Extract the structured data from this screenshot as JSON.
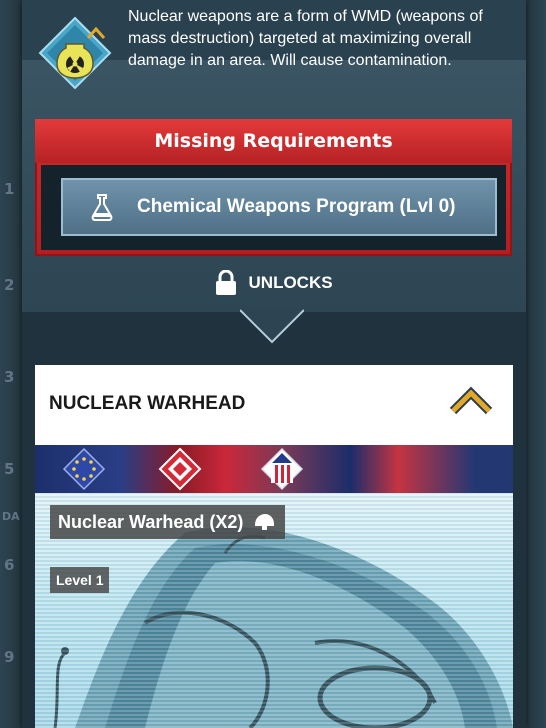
{
  "description": {
    "text": "Nuclear weapons are a form of WMD (weapons of mass destruction) targeted at maximizing overall damage in an area. Will cause contamination.",
    "icon": "nuclear-hazard-icon"
  },
  "requirements": {
    "title": "Missing Requirements",
    "items": [
      {
        "label": "Chemical Weapons Program (Lvl 0)",
        "icon": "flask-research-icon"
      }
    ]
  },
  "unlocks": {
    "label": "UNLOCKS",
    "icon": "lock-icon"
  },
  "card": {
    "title": "NUCLEAR WARHEAD",
    "rank_icon": "chevron-rank-icon",
    "factions": [
      "eu-faction-icon",
      "red-faction-icon",
      "us-faction-icon"
    ],
    "item_name": "Nuclear Warhead (X2)",
    "item_icon": "helmet-icon",
    "level": "Level 1"
  },
  "background": {
    "left_numbers": [
      "1",
      "2",
      "3",
      "5",
      "6",
      "9"
    ],
    "left_label": "DA"
  },
  "colors": {
    "panel": "#2f4755",
    "requirement_red": "#c8262a",
    "requirement_item": "#5f839b",
    "card_white": "#ffffff",
    "gold": "#e0a92a"
  }
}
